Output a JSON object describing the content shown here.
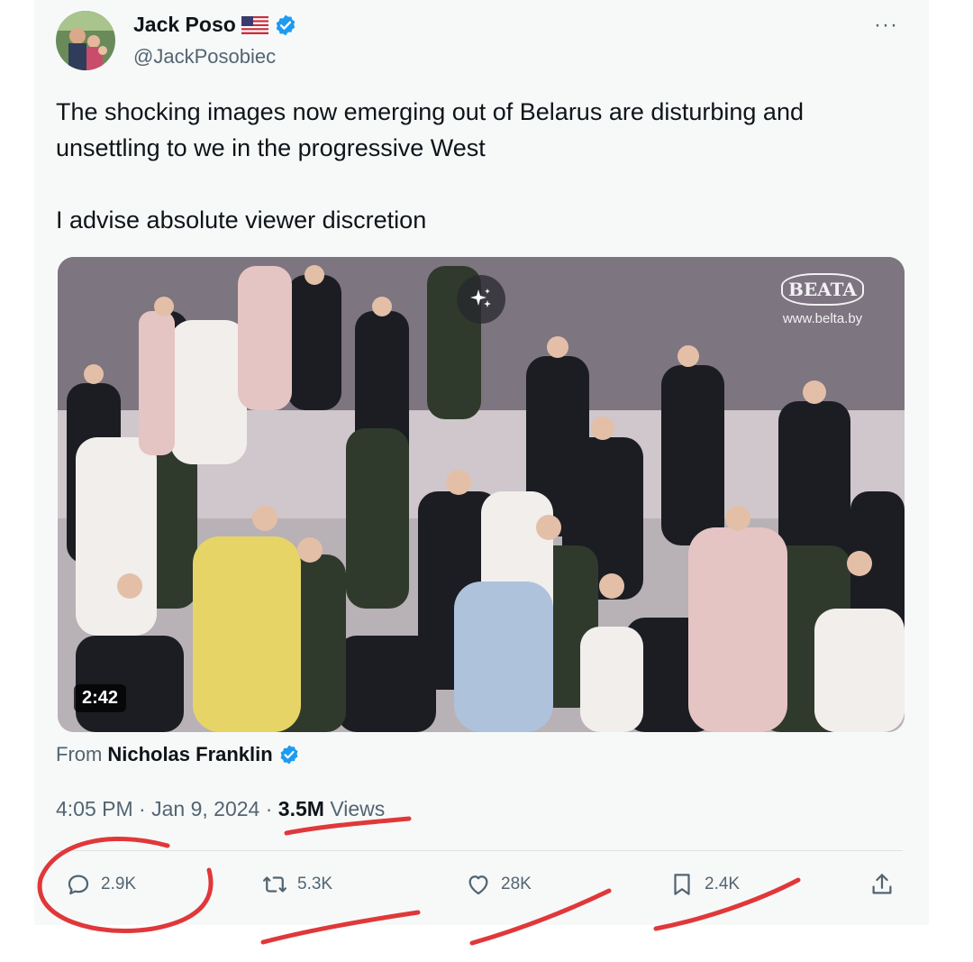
{
  "tweet": {
    "author": {
      "display_name": "Jack Poso",
      "handle": "@JackPosobiec",
      "flag": "us-flag-emoji",
      "verified": true
    },
    "more_label": "···",
    "text_lines": [
      "The shocking images now emerging out of Belarus are disturbing and",
      "unsettling to we in the progressive West"
    ],
    "text_line_3": "I advise absolute viewer discretion",
    "media": {
      "duration": "2:42",
      "watermark_logo": "BEATA",
      "watermark_site": "www.belta.by",
      "sparkle_icon": "sparkle-icon"
    },
    "attribution": {
      "prefix": "From",
      "source": "Nicholas Franklin"
    },
    "meta": {
      "time": "4:05 PM",
      "separator": "·",
      "date": "Jan 9, 2024",
      "views_count": "3.5M",
      "views_label": "Views"
    },
    "actions": {
      "replies": "2.9K",
      "retweets": "5.3K",
      "likes": "28K",
      "bookmarks": "2.4K"
    }
  },
  "colors": {
    "text_primary": "#0f1419",
    "text_secondary": "#536471",
    "verified_blue": "#1d9bf0",
    "annotation_red": "#e0383a"
  }
}
